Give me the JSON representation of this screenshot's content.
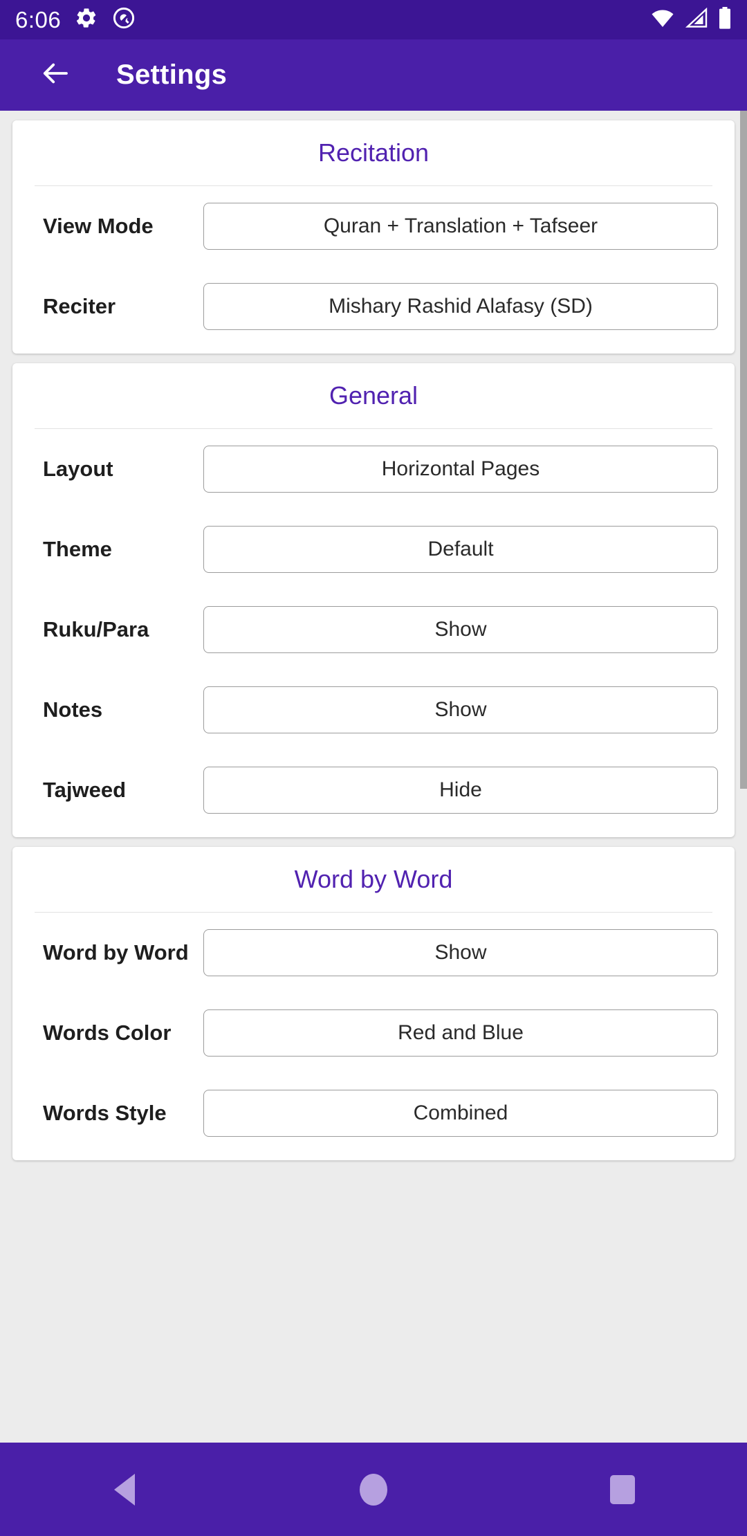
{
  "status_bar": {
    "clock": "6:06",
    "left_icons": [
      "gear-icon",
      "circle-q-icon"
    ],
    "right_icons": [
      "wifi-icon",
      "cell-signal-icon",
      "battery-icon"
    ],
    "background": "#3c1594"
  },
  "app_bar": {
    "back_icon": "arrow-left-icon",
    "title": "Settings",
    "background": "#4a1fa8"
  },
  "accent_color": "#5122b0",
  "cards": [
    {
      "title": "Recitation",
      "rows": [
        {
          "label": "View Mode",
          "value": "Quran + Translation + Tafseer"
        },
        {
          "label": "Reciter",
          "value": "Mishary Rashid Alafasy (SD)"
        }
      ]
    },
    {
      "title": "General",
      "rows": [
        {
          "label": "Layout",
          "value": "Horizontal Pages"
        },
        {
          "label": "Theme",
          "value": "Default"
        },
        {
          "label": "Ruku/Para",
          "value": "Show"
        },
        {
          "label": "Notes",
          "value": "Show"
        },
        {
          "label": "Tajweed",
          "value": "Hide"
        }
      ]
    },
    {
      "title": "Word by Word",
      "rows": [
        {
          "label": "Word by Word",
          "value": "Show"
        },
        {
          "label": "Words Color",
          "value": "Red and Blue"
        },
        {
          "label": "Words Style",
          "value": "Combined"
        }
      ]
    }
  ],
  "nav_bar": {
    "back": "nav-back-icon",
    "home": "nav-home-icon",
    "recents": "nav-recents-icon",
    "background": "#4a1fa8"
  }
}
